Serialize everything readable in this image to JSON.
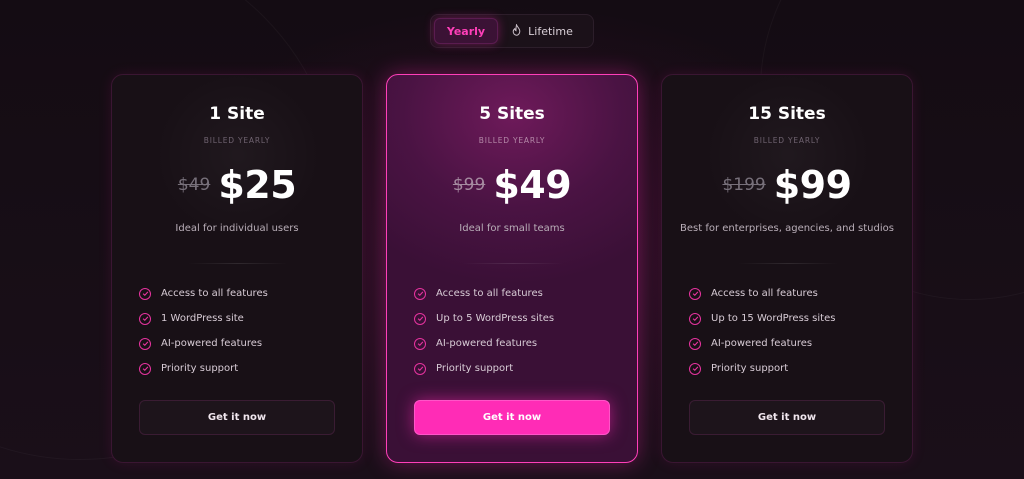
{
  "toggle": {
    "options": [
      {
        "label": "Yearly",
        "active": true
      },
      {
        "label": "Lifetime",
        "active": false,
        "icon": "flame-icon"
      }
    ]
  },
  "plans": [
    {
      "title": "1 Site",
      "billing": "BILLED YEARLY",
      "old_price": "$49",
      "price": "$25",
      "description": "Ideal for individual users",
      "features": [
        "Access to all features",
        "1 WordPress site",
        "AI-powered features",
        "Priority support"
      ],
      "cta": "Get it now",
      "featured": false
    },
    {
      "title": "5 Sites",
      "billing": "BILLED YEARLY",
      "old_price": "$99",
      "price": "$49",
      "description": "Ideal for small teams",
      "features": [
        "Access to all features",
        "Up to 5 WordPress sites",
        "AI-powered features",
        "Priority support"
      ],
      "cta": "Get it now",
      "featured": true
    },
    {
      "title": "15 Sites",
      "billing": "BILLED YEARLY",
      "old_price": "$199",
      "price": "$99",
      "description": "Best for enterprises, agencies, and studios",
      "features": [
        "Access to all features",
        "Up to 15 WordPress sites",
        "AI-powered features",
        "Priority support"
      ],
      "cta": "Get it now",
      "featured": false
    }
  ],
  "colors": {
    "accent": "#ff2cb6",
    "background": "#140c13",
    "card": "#181016"
  }
}
